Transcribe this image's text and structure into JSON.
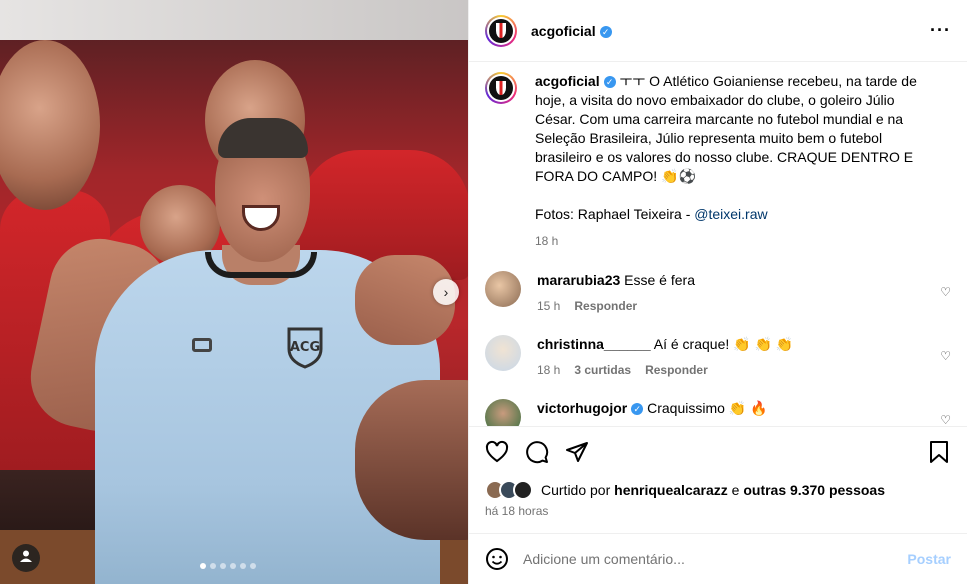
{
  "post": {
    "username": "acgoficial",
    "caption_prefix": "ㅜㅜ",
    "caption": "O Atlético Goianiense recebeu, na tarde de hoje, a visita do novo embaixador do clube, o goleiro Júlio César. Com uma carreira marcante no futebol mundial e na Seleção Brasileira, Júlio representa muito bem o futebol brasileiro e os valores do nosso clube. CRAQUE DENTRO E FORA DO CAMPO! 👏⚽",
    "photo_credit": "Fotos: Raphael Teixeira - ",
    "photo_handle": "@teixei.raw",
    "time": "18 h"
  },
  "comments": [
    {
      "user": "mararubia23",
      "text": "Esse é fera",
      "time": "15 h",
      "reply": "Responder",
      "likes": ""
    },
    {
      "user": "christinna______",
      "text": "Aí é craque! 👏 👏 👏",
      "time": "18 h",
      "likes": "3 curtidas",
      "reply": "Responder"
    },
    {
      "user": "victorhugojor",
      "text": "Craquissimo 👏 🔥",
      "time": "",
      "likes": "",
      "reply": ""
    }
  ],
  "likes_line": {
    "prefix": "Curtido por ",
    "user": "henriquealcarazz",
    "mid": " e ",
    "rest": "outras 9.370 pessoas"
  },
  "ago": "há 18 horas",
  "add_comment_placeholder": "Adicione um comentário...",
  "post_button": "Postar",
  "colors": {
    "verified": "#3897f0",
    "link": "#00376b",
    "post_disabled": "#a6cfff"
  },
  "icons": [
    "more-options-icon",
    "heart-icon",
    "comment-icon",
    "share-icon",
    "bookmark-icon",
    "emoji-icon",
    "next-arrow-icon",
    "user-tag-icon"
  ]
}
